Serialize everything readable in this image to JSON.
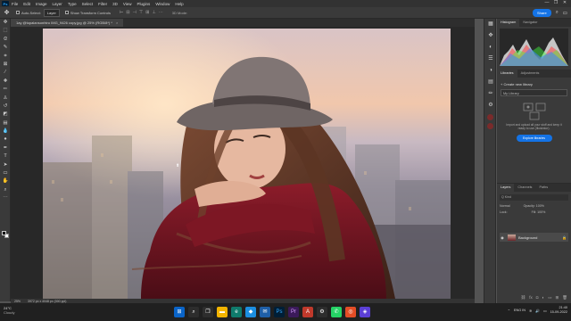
{
  "menubar": {
    "logo": "Ps",
    "items": [
      "File",
      "Edit",
      "Image",
      "Layer",
      "Type",
      "Select",
      "Filter",
      "3D",
      "View",
      "Plugins",
      "Window",
      "Help"
    ],
    "controls": [
      "—",
      "❐",
      "✕"
    ]
  },
  "options": {
    "auto_select_label": "Auto-Select:",
    "layer_dropdown": "Layer",
    "show_transform_label": "Show Transform Controls",
    "mode3d_label": "3D Mode:",
    "share_label": "Share"
  },
  "tab": {
    "title": "1ay @topalansonhtro IMG_9426 copy.jpg @ 25% (RGB/8*) *",
    "close": "×"
  },
  "status": {
    "zoom": "25%",
    "doc": "3972 px x 4048 px (300 ppi)"
  },
  "panels": {
    "top_tabs": [
      "Histogram",
      "Navigator"
    ],
    "mid_tabs": [
      "Libraries",
      "Adjustments"
    ],
    "create_library": "+ Create new library",
    "search_value": "My Library",
    "lib_desc": "Import and upload all your stuff and keep it ready to use (Illustrator).",
    "lib_button": "Explore libraries",
    "layer_tabs": [
      "Layers",
      "Channels",
      "Paths"
    ],
    "kind_label": "Q Kind",
    "normal_label": "Normal",
    "opacity_label": "Opacity: 100%",
    "lock_label": "Lock:",
    "fill_label": "Fill: 100%",
    "layer_name": "Background"
  },
  "taskbar": {
    "temp": "24°C",
    "condition": "Cloudy",
    "lang": "ENG\nIN",
    "time": "21:40",
    "date": "15-09-2022"
  },
  "colors": {
    "accent": "#1473e6",
    "foreground": "#000000",
    "background": "#ffffff"
  }
}
